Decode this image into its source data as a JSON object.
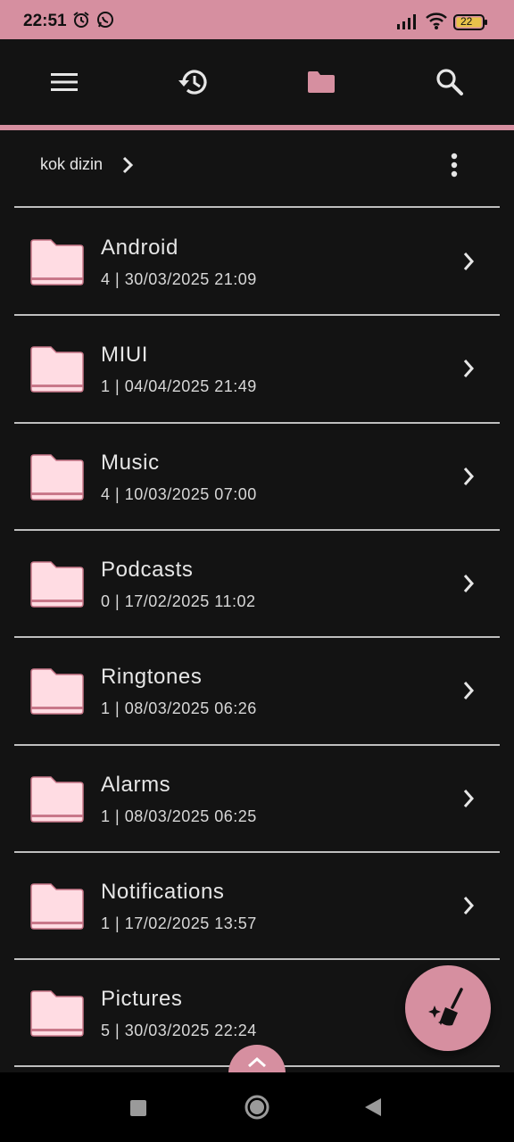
{
  "status": {
    "time": "22:51",
    "battery": "22",
    "accent": "#d68fa0"
  },
  "toolbar": {
    "icons": [
      "menu-icon",
      "history-icon",
      "folder-icon",
      "search-icon"
    ]
  },
  "breadcrumb": {
    "label": "kok dizin"
  },
  "folders": [
    {
      "name": "Android",
      "meta": "4 | 30/03/2025 21:09"
    },
    {
      "name": "MIUI",
      "meta": "1 | 04/04/2025 21:49"
    },
    {
      "name": "Music",
      "meta": "4 | 10/03/2025 07:00"
    },
    {
      "name": "Podcasts",
      "meta": "0 | 17/02/2025 11:02"
    },
    {
      "name": "Ringtones",
      "meta": "1 | 08/03/2025 06:26"
    },
    {
      "name": "Alarms",
      "meta": "1 | 08/03/2025 06:25"
    },
    {
      "name": "Notifications",
      "meta": "1 | 17/02/2025 13:57"
    },
    {
      "name": "Pictures",
      "meta": "5 | 30/03/2025 22:24"
    }
  ],
  "fab": {
    "icon": "clean-broom-icon"
  },
  "nav": {
    "icons": [
      "recents-square-icon",
      "home-circle-icon",
      "back-triangle-icon"
    ]
  }
}
